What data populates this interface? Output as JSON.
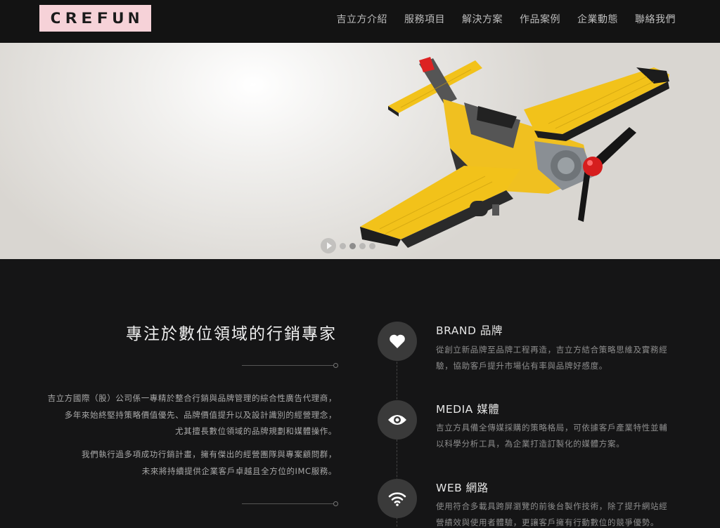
{
  "header": {
    "logo_text": "CREFUN",
    "nav": [
      "吉立方介紹",
      "服務項目",
      "解決方案",
      "作品案例",
      "企業動態",
      "聯絡我們"
    ]
  },
  "hero": {
    "slide_count": 4,
    "active_slide": 2
  },
  "intro": {
    "title": "專注於數位領域的行銷專家",
    "para1": [
      "吉立方國際（股）公司係一專精於整合行銷與品牌管理的綜合性廣告代理商，",
      "多年來始終堅持策略價值優先、品牌價值提升以及設計識別的經營理念，",
      "尤其擅長數位領域的品牌規劃和媒體操作。"
    ],
    "para2": [
      "我們執行過多項成功行銷計畫，擁有傑出的經營團隊與專案顧問群，",
      "未來將持續提供企業客戶卓越且全方位的IMC服務。"
    ]
  },
  "features": [
    {
      "icon": "heart-icon",
      "title": "BRAND 品牌",
      "desc": [
        "從創立新品牌至品牌工程再造，吉立方結合策略思維及實務經",
        "驗，協助客戶提升市場佔有率與品牌好感度。"
      ]
    },
    {
      "icon": "eye-icon",
      "title": "MEDIA 媒體",
      "desc": [
        "吉立方具備全傳媒採購的策略格局，可依據客戶產業特性並輔",
        "以科學分析工具，為企業打造訂製化的媒體方案。"
      ]
    },
    {
      "icon": "wifi-icon",
      "title": "WEB 網路",
      "desc": [
        "使用符合多載具跨屏瀏覽的前後台製作技術，除了提升網站經",
        "營績效與使用者體驗，更讓客戶擁有行動數位的競爭優勢。"
      ]
    }
  ]
}
